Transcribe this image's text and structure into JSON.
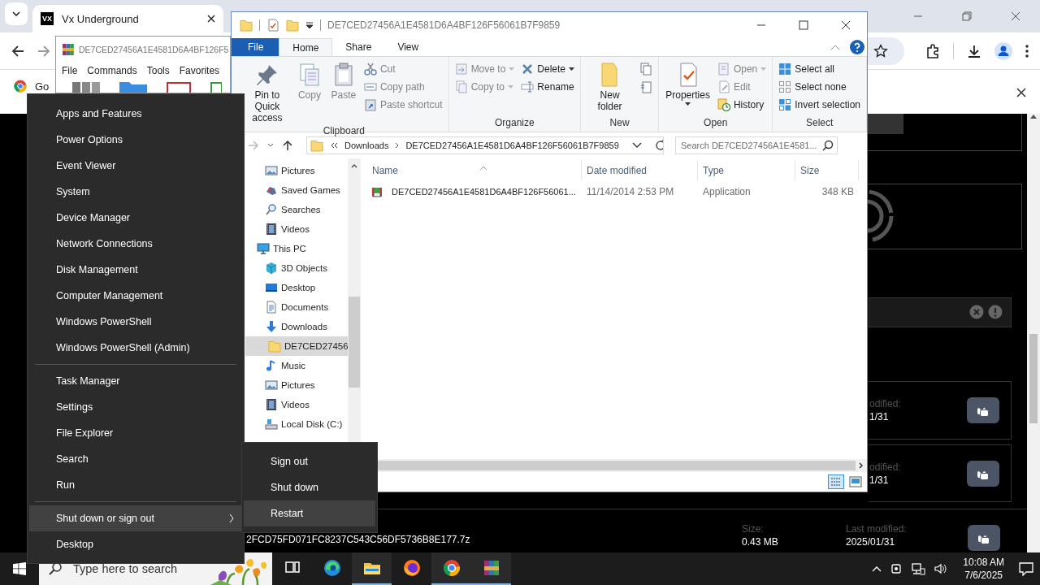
{
  "browser": {
    "tabs": [
      {
        "favicon_text": "VX",
        "title": "Vx Underground",
        "selected": true
      }
    ],
    "bookmarks": [
      {
        "label": "Go"
      }
    ],
    "cards": [
      {
        "label": "odified:",
        "value": "1/31"
      },
      {
        "label": "odified:",
        "value": "1/31"
      }
    ],
    "file_card": {
      "name": "2FCD75FD071FC8237C543C56DF5736B8E177.7z",
      "size_label": "Size:",
      "size": "0.43 MB",
      "modified_label": "Last modified:",
      "modified": "2025/01/31"
    }
  },
  "winrar": {
    "title": "DE7CED27456A1E4581D6A4BF126F5",
    "menu": [
      "File",
      "Commands",
      "Tools",
      "Favorites"
    ]
  },
  "explorer": {
    "title": "DE7CED27456A1E4581D6A4BF126F56061B7F9859",
    "ribbon_tabs": [
      {
        "label": "File",
        "kind": "file",
        "selected": false
      },
      {
        "label": "Home",
        "kind": "tab",
        "selected": true
      },
      {
        "label": "Share",
        "kind": "tab",
        "selected": false
      },
      {
        "label": "View",
        "kind": "tab",
        "selected": false
      }
    ],
    "ribbon_groups": [
      {
        "title": "Clipboard",
        "large": [
          {
            "kind": "pin",
            "label": "Pin to Quick access",
            "disabled": false
          },
          {
            "kind": "copy",
            "label": "Copy",
            "disabled": true
          },
          {
            "kind": "paste",
            "label": "Paste",
            "disabled": true
          }
        ],
        "small": [
          {
            "kind": "cut",
            "label": "Cut",
            "disabled": true
          },
          {
            "kind": "copy-path",
            "label": "Copy path",
            "disabled": true
          },
          {
            "kind": "paste-shortcut",
            "label": "Paste shortcut",
            "disabled": true
          }
        ]
      },
      {
        "title": "Organize",
        "small": [
          {
            "kind": "move-to",
            "label": "Move to",
            "disabled": true
          },
          {
            "kind": "copy-to",
            "label": "Copy to",
            "disabled": true
          }
        ],
        "small2": [
          {
            "kind": "delete",
            "label": "Delete",
            "disabled": false
          },
          {
            "kind": "rename",
            "label": "Rename",
            "disabled": false
          }
        ]
      },
      {
        "title": "New",
        "large": [
          {
            "kind": "new-folder",
            "label": "New folder",
            "disabled": false
          }
        ],
        "small": [
          {
            "kind": "new-item"
          },
          {
            "kind": "easy-access"
          }
        ]
      },
      {
        "title": "Open",
        "large": [
          {
            "kind": "properties",
            "label": "Properties",
            "disabled": false
          }
        ],
        "small": [
          {
            "kind": "open",
            "label": "Open",
            "disabled": true
          },
          {
            "kind": "edit",
            "label": "Edit",
            "disabled": true
          },
          {
            "kind": "history",
            "label": "History",
            "disabled": false
          }
        ]
      },
      {
        "title": "Select",
        "small": [
          {
            "kind": "select-all",
            "label": "Select all",
            "disabled": false
          },
          {
            "kind": "select-none",
            "label": "Select none",
            "disabled": false
          },
          {
            "kind": "invert",
            "label": "Invert selection",
            "disabled": false
          }
        ]
      }
    ],
    "address": [
      "Downloads",
      "DE7CED27456A1E4581D6A4BF126F56061B7F9859"
    ],
    "search": {
      "placeholder": "Search DE7CED27456A1E4581..."
    },
    "nav_items": [
      {
        "kind": "pictures",
        "label": "Pictures",
        "selected": false
      },
      {
        "kind": "games",
        "label": "Saved Games",
        "selected": false
      },
      {
        "kind": "searches",
        "label": "Searches",
        "selected": false
      },
      {
        "kind": "videos",
        "label": "Videos",
        "selected": false
      },
      {
        "kind": "pc",
        "label": "This PC",
        "selected": false,
        "children": [
          {
            "kind": "cube",
            "label": "3D Objects",
            "selected": false
          },
          {
            "kind": "desktop",
            "label": "Desktop",
            "selected": false
          },
          {
            "kind": "documents",
            "label": "Documents",
            "selected": false
          },
          {
            "kind": "downloads",
            "label": "Downloads",
            "selected": false,
            "children": [
              {
                "kind": "folder",
                "label": "DE7CED27456",
                "selected": true
              }
            ]
          },
          {
            "kind": "music",
            "label": "Music",
            "selected": false
          },
          {
            "kind": "pictures",
            "label": "Pictures",
            "selected": false
          },
          {
            "kind": "videos",
            "label": "Videos",
            "selected": false
          },
          {
            "kind": "disk",
            "label": "Local Disk (C:)",
            "selected": false
          }
        ]
      }
    ],
    "columns": [
      "Name",
      "Date modified",
      "Type",
      "Size"
    ],
    "rows": [
      {
        "name": "DE7CED27456A1E4581D6A4BF126F56061...",
        "date": "11/14/2014 2:53 PM",
        "type": "Application",
        "size": "348 KB"
      }
    ]
  },
  "winx_menu": {
    "groups": [
      [
        "Apps and Features",
        "Power Options",
        "Event Viewer",
        "System",
        "Device Manager",
        "Network Connections",
        "Disk Management",
        "Computer Management",
        "Windows PowerShell",
        "Windows PowerShell (Admin)"
      ],
      [
        "Task Manager",
        "Settings",
        "File Explorer",
        "Search",
        "Run"
      ]
    ],
    "last_group": [
      {
        "label": "Shut down or sign out",
        "has_submenu": true,
        "selected": true
      },
      {
        "label": "Desktop",
        "has_submenu": false,
        "selected": false
      }
    ],
    "submenu": [
      {
        "label": "Sign out",
        "selected": false
      },
      {
        "label": "Shut down",
        "selected": false
      },
      {
        "label": "Restart",
        "selected": true
      }
    ]
  },
  "taskbar": {
    "search": {
      "placeholder": "Type here to search"
    },
    "apps": [
      {
        "kind": "task-view",
        "running": false
      },
      {
        "kind": "edge",
        "running": false
      },
      {
        "kind": "explorer",
        "running": true
      },
      {
        "kind": "firefox",
        "running": false
      },
      {
        "kind": "chrome",
        "running": true
      },
      {
        "kind": "winrar",
        "running": true
      }
    ],
    "time": "10:08 AM",
    "date": "7/6/2025"
  }
}
